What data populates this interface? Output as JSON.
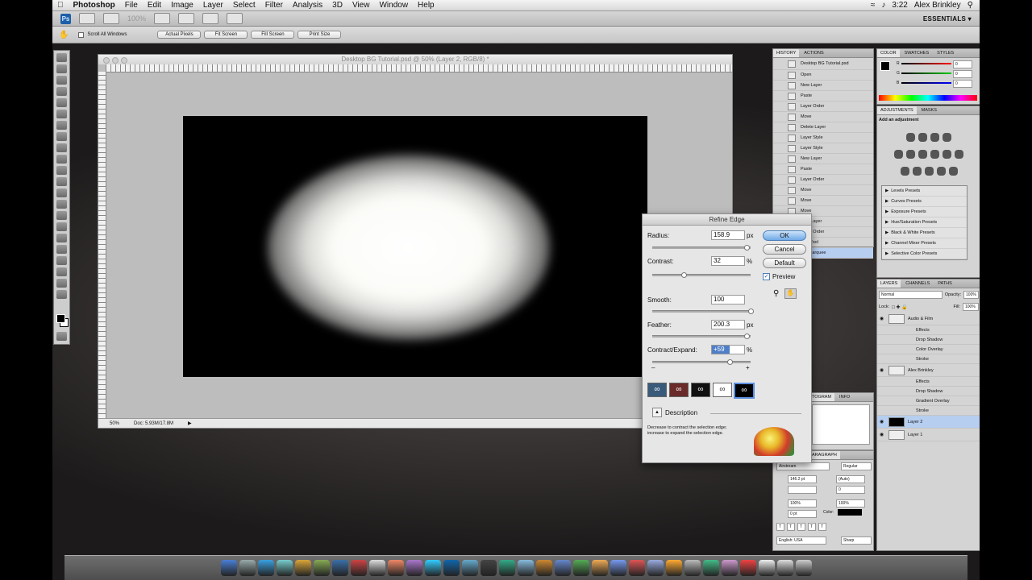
{
  "menubar": {
    "app": "Photoshop",
    "items": [
      "File",
      "Edit",
      "Image",
      "Layer",
      "Select",
      "Filter",
      "Analysis",
      "3D",
      "View",
      "Window",
      "Help"
    ],
    "time": "3:22",
    "user": "Alex Brinkley"
  },
  "appbar": {
    "zoom": "100%",
    "workspace": "ESSENTIALS ▾",
    "ps_badge": "Ps"
  },
  "options": {
    "scroll_all": "Scroll All Windows",
    "buttons": [
      "Actual Pixels",
      "Fit Screen",
      "Fill Screen",
      "Print Size"
    ]
  },
  "document": {
    "title": "Desktop BG Tutorial.psd @ 50% (Layer 2, RGB/8) *",
    "zoom": "50%",
    "doc_info": "Doc: 5.93M/17.8M"
  },
  "history": {
    "tabs": [
      "HISTORY",
      "ACTIONS"
    ],
    "snapshot": "Desktop BG Tutorial.psd",
    "items": [
      "Open",
      "New Layer",
      "Paste",
      "Layer Order",
      "Move",
      "Delete Layer",
      "Layer Style",
      "Layer Style",
      "New Layer",
      "Paste",
      "Layer Order",
      "Move",
      "Move",
      "Move",
      "New Layer",
      "Layer Order",
      "ngle Tool",
      "ical Marquee"
    ]
  },
  "color_panel": {
    "tabs": [
      "COLOR",
      "SWATCHES",
      "STYLES"
    ],
    "r": "0",
    "g": "0",
    "b": "0",
    "labels": [
      "R",
      "G",
      "B"
    ]
  },
  "adjustments": {
    "tabs": [
      "ADJUSTMENTS",
      "MASKS"
    ],
    "heading": "Add an adjustment",
    "presets": [
      "Levels Presets",
      "Curves Presets",
      "Exposure Presets",
      "Hue/Saturation Presets",
      "Black & White Presets",
      "Channel Mixer Presets",
      "Selective Color Presets"
    ]
  },
  "layers": {
    "tabs": [
      "LAYERS",
      "CHANNELS",
      "PATHS"
    ],
    "blend": "Normal",
    "opacity_label": "Opacity:",
    "opacity": "100%",
    "lock_label": "Lock:",
    "fill_label": "Fill:",
    "fill": "100%",
    "rows": [
      {
        "name": "Audio & Film",
        "sub": false
      },
      {
        "name": "Effects",
        "sub": true
      },
      {
        "name": "Drop Shadow",
        "sub": true
      },
      {
        "name": "Color Overlay",
        "sub": true
      },
      {
        "name": "Stroke",
        "sub": true
      },
      {
        "name": "Alex Brinkley",
        "sub": false
      },
      {
        "name": "Effects",
        "sub": true
      },
      {
        "name": "Drop Shadow",
        "sub": true
      },
      {
        "name": "Gradient Overlay",
        "sub": true
      },
      {
        "name": "Stroke",
        "sub": true
      },
      {
        "name": "Layer 2",
        "sub": false
      },
      {
        "name": "Layer 1",
        "sub": false
      }
    ]
  },
  "histogram": {
    "tabs": [
      "TOGRAM",
      "INFO"
    ]
  },
  "character": {
    "tab": "ARAGRAPH",
    "font": "Airstream",
    "style": "Regular",
    "size": "146.2 pt",
    "leading": "(Auto)",
    "tracking": "0",
    "vscale": "100%",
    "hscale": "100%",
    "baseline": "0 pt",
    "color_label": "Color:",
    "language": "English: USA",
    "aa": "Sharp"
  },
  "refine_edge": {
    "title": "Refine Edge",
    "radius_label": "Radius:",
    "radius": "158.9",
    "radius_unit": "px",
    "contrast_label": "Contrast:",
    "contrast": "32",
    "contrast_unit": "%",
    "smooth_label": "Smooth:",
    "smooth": "100",
    "feather_label": "Feather:",
    "feather": "200.3",
    "feather_unit": "px",
    "ce_label": "Contract/Expand:",
    "ce": "+59",
    "ce_unit": "%",
    "ok": "OK",
    "cancel": "Cancel",
    "default": "Default",
    "preview": "Preview",
    "minus": "–",
    "plus": "+",
    "description_label": "Description",
    "description_text": "Decrease to contract the selection edge; increase to expand the selection edge.",
    "slider_fraction": {
      "radius": 0.96,
      "contrast": 0.32,
      "smooth": 1.0,
      "feather": 0.96,
      "ce": 0.79
    }
  }
}
